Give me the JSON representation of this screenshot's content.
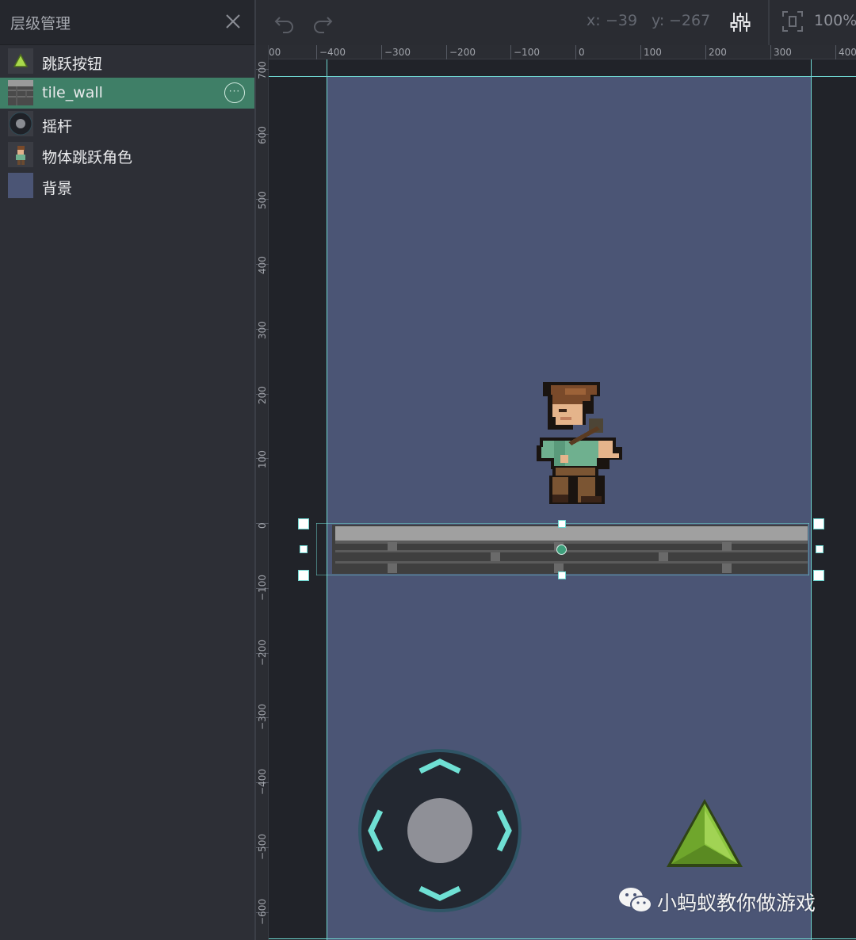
{
  "layer_panel": {
    "title": "层级管理",
    "layers": [
      {
        "label": "跳跃按钮",
        "thumb": "green-triangle-icon",
        "selected": false
      },
      {
        "label": "tile_wall",
        "thumb": "stone-wall-icon",
        "selected": true
      },
      {
        "label": "摇杆",
        "thumb": "joystick-icon",
        "selected": false
      },
      {
        "label": "物体跳跃角色",
        "thumb": "character-icon",
        "selected": false
      },
      {
        "label": "背景",
        "thumb": "background-swatch",
        "selected": false
      }
    ],
    "more_glyph": "···"
  },
  "toolbar": {
    "x_label": "x:",
    "x_value": "−39",
    "y_label": "y:",
    "y_value": "−267",
    "zoom": "100%"
  },
  "ruler": {
    "x_labels": [
      "00",
      "−400",
      "−300",
      "−200",
      "−100",
      "0",
      "100",
      "200",
      "300",
      "400"
    ],
    "y_labels": [
      "700",
      "600",
      "500",
      "400",
      "300",
      "200",
      "100",
      "0",
      "−100",
      "−200",
      "−300",
      "−400",
      "−500",
      "−600"
    ]
  },
  "watermark": {
    "text": "小蚂蚁教你做游戏"
  },
  "colors": {
    "selected_row": "#3f7f67",
    "scene_background": "#4b5575",
    "guide": "#6fd6d0",
    "panel": "#2d2f36"
  }
}
